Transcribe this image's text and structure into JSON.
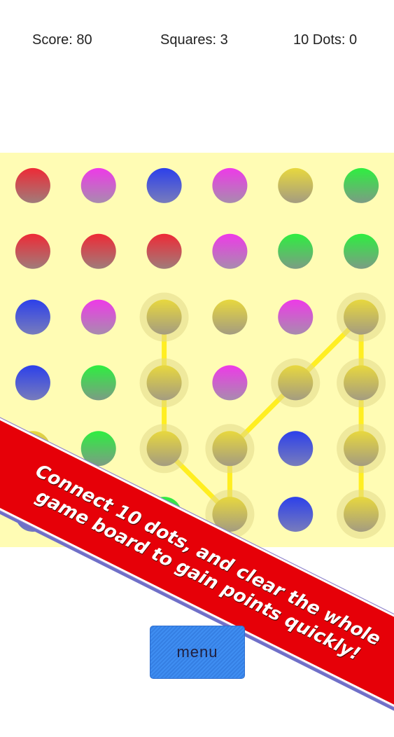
{
  "hud": {
    "score_label": "Score: 80",
    "squares_label": "Squares: 3",
    "ten_dots_label": "10 Dots: 0"
  },
  "colors": {
    "red": [
      "#ee2a36",
      "#a07c7a"
    ],
    "magenta": [
      "#ee3ae8",
      "#a88bae"
    ],
    "blue": [
      "#2c40ea",
      "#787cbc"
    ],
    "yellow": [
      "#e8d83e",
      "#a49c80"
    ],
    "green": [
      "#2eee40",
      "#7c9c84"
    ],
    "board_bg": "#fffcb4",
    "link_line": "#ffee22",
    "banner": "#e60008",
    "menu_button": "#3f8ef2"
  },
  "board": {
    "rows": 6,
    "cols": 6,
    "grid": [
      [
        "red",
        "magenta",
        "blue",
        "magenta",
        "yellow",
        "green"
      ],
      [
        "red",
        "red",
        "red",
        "magenta",
        "green",
        "green"
      ],
      [
        "blue",
        "magenta",
        "yellow",
        "yellow",
        "magenta",
        "yellow"
      ],
      [
        "blue",
        "green",
        "yellow",
        "magenta",
        "yellow",
        "yellow"
      ],
      [
        "yellow",
        "green",
        "yellow",
        "yellow",
        "blue",
        "yellow"
      ],
      [
        "blue",
        "yellow",
        "green",
        "yellow",
        "blue",
        "yellow"
      ]
    ],
    "selected_path": [
      [
        2,
        2
      ],
      [
        3,
        2
      ],
      [
        4,
        2
      ],
      [
        5,
        3
      ],
      [
        4,
        3
      ],
      [
        3,
        4
      ],
      [
        2,
        5
      ],
      [
        3,
        5
      ],
      [
        4,
        5
      ],
      [
        5,
        5
      ]
    ]
  },
  "banner": {
    "text": "Connect 10 dots, and clear the whole game board to gain points quickly!"
  },
  "menu": {
    "label": "menu"
  }
}
